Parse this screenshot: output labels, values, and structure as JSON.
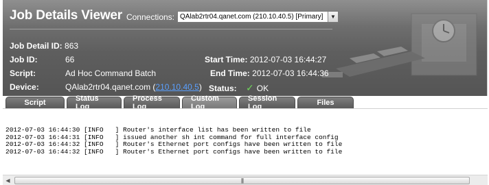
{
  "header": {
    "title": "Job Details Viewer",
    "connections_label": "Connections:",
    "connection_value": "QAlab2rtr04.qanet.com (210.10.40.5) [Primary]"
  },
  "details": {
    "job_detail_id_label": "Job Detail ID:",
    "job_detail_id": "863",
    "job_id_label": "Job ID:",
    "job_id": "66",
    "script_label": "Script:",
    "script": "Ad Hoc Command Batch",
    "device_label": "Device:",
    "device_name": "QAlab2rtr04.qanet.com (",
    "device_ip": "210.10.40.5",
    "device_suffix": ")",
    "start_time_label": "Start Time:",
    "start_time": "2012-07-03 16:44:27",
    "end_time_label": "End Time:",
    "end_time": "2012-07-03 16:44:36",
    "status_label": "Status:",
    "status": "OK",
    "status_icon": "check-icon"
  },
  "tabs": [
    {
      "label": "Script"
    },
    {
      "label": "Status Log"
    },
    {
      "label": "Process Log"
    },
    {
      "label": "Custom Log",
      "active": true
    },
    {
      "label": "Session Log"
    },
    {
      "label": "Files"
    }
  ],
  "log_lines": [
    "2012-07-03 16:44:30 [INFO   ] Router's interface list has been written to file",
    "2012-07-03 16:44:31 [INFO   ] issued another sh int command for full interface config",
    "2012-07-03 16:44:32 [INFO   ] Router's Ethernet port configs have been written to file",
    "2012-07-03 16:44:32 [INFO   ] Router's Ethernet port configs have been written to file"
  ],
  "colors": {
    "header_bg": "#5e5e5e",
    "link": "#5aa0ff",
    "status_ok": "#6fd85a"
  }
}
